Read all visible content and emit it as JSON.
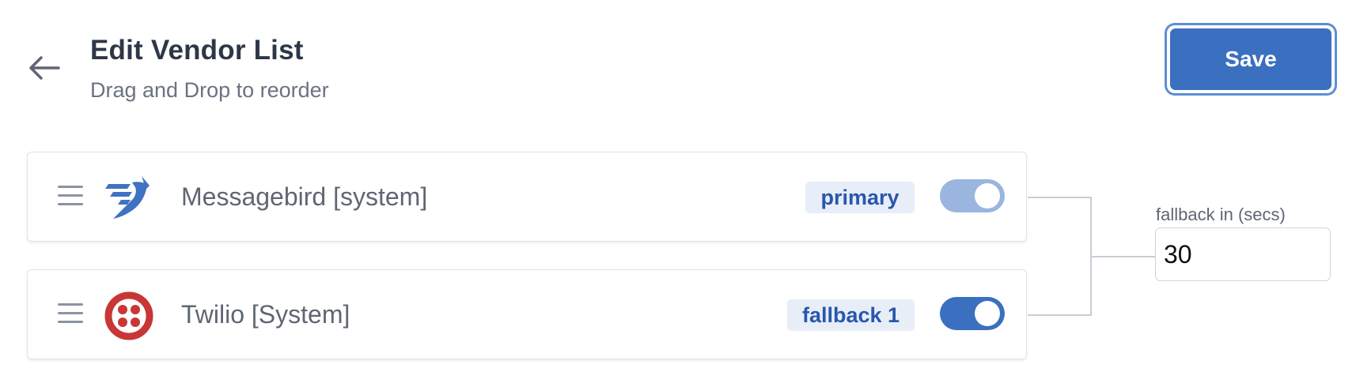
{
  "header": {
    "title": "Edit Vendor List",
    "subtitle": "Drag and Drop to reorder",
    "save_label": "Save",
    "back_icon": "arrow-left-icon"
  },
  "vendors": [
    {
      "name": "Messagebird [system]",
      "badge": "primary",
      "logo_icon": "messagebird-logo",
      "enabled": true,
      "toggle_color": "#9ab5de"
    },
    {
      "name": "Twilio [System]",
      "badge": "fallback 1",
      "logo_icon": "twilio-logo",
      "enabled": true,
      "toggle_color": "#3b6fc0"
    }
  ],
  "fallback": {
    "label": "fallback in (secs)",
    "value": "30"
  },
  "colors": {
    "accent": "#3b6fc0",
    "badge_bg": "#e8eef8",
    "badge_text": "#2a56ad",
    "twilio_red": "#c93636",
    "messagebird_blue": "#3f72c2"
  }
}
